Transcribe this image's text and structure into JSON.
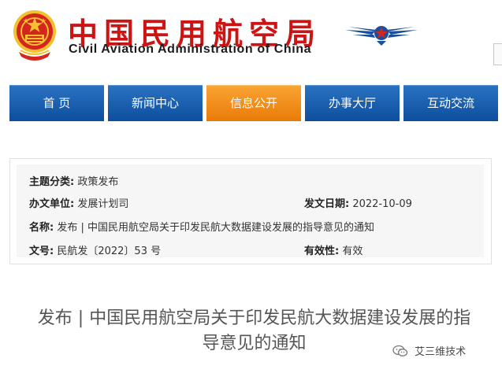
{
  "header": {
    "title_cn": "中国民用航空局",
    "title_en": "Civil Aviation Administration of China",
    "emblem_icon": "national-emblem-icon",
    "logo_icon": "caac-wings-logo-icon",
    "title_color": "#cc1414"
  },
  "nav": {
    "items": [
      {
        "label": "首 页"
      },
      {
        "label": "新闻中心"
      },
      {
        "label": "信息公开"
      },
      {
        "label": "办事大厅"
      },
      {
        "label": "互动交流"
      }
    ],
    "active_index": 2,
    "color": "#1a62b4",
    "active_color": "#f3921e"
  },
  "info": {
    "topic_label": "主题分类:",
    "topic_value": "政策发布",
    "office_label": "办文单位:",
    "office_value": "发展计划司",
    "date_label": "发文日期:",
    "date_value": "2022-10-09",
    "name_label": "名称:",
    "name_value": "发布 | 中国民用航空局关于印发民航大数据建设发展的指导意见的通知",
    "doc_label": "文号:",
    "doc_value": "民航发〔2022〕53 号",
    "valid_label": "有效性:",
    "valid_value": "有效"
  },
  "article": {
    "title_line1": "发布 | 中国民用航空局关于印发民航大数据建设发展的指",
    "title_line2": "导意见的通知"
  },
  "watermark": {
    "text": "艾三维技术",
    "icon": "wechat-icon"
  }
}
